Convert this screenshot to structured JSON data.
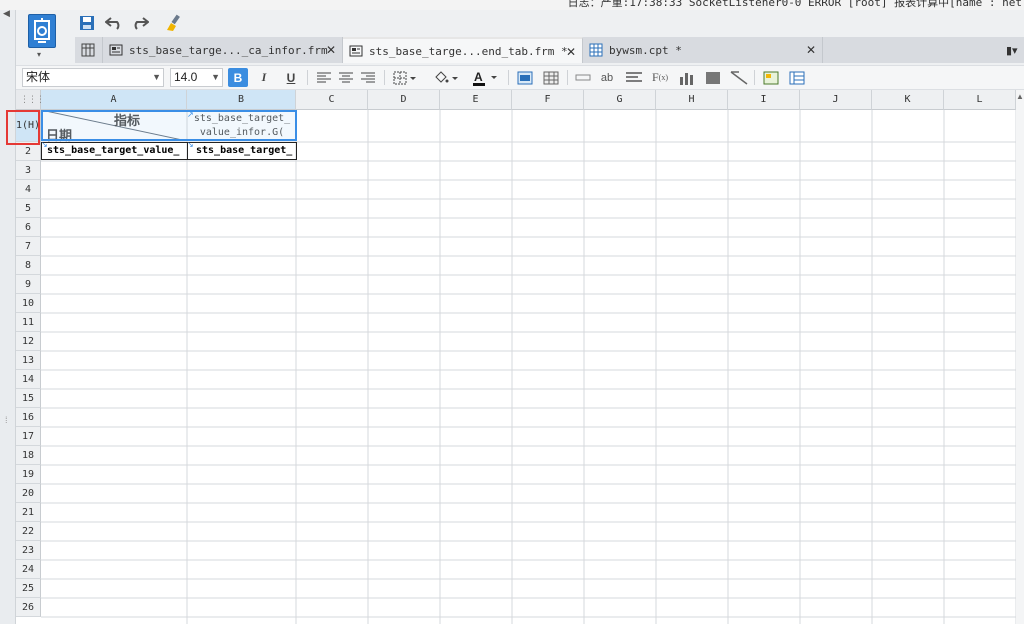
{
  "log_strip": {
    "text": "日志：严重:17:38:33 SocketListener0-0 ERROR [root] 报表计算中[name : net"
  },
  "toolbar": {
    "logo_icon": "designer-logo-icon",
    "quick_actions": [
      {
        "name": "save-icon",
        "glyph": "💾"
      },
      {
        "name": "undo-icon",
        "glyph": "↶"
      },
      {
        "name": "redo-icon",
        "glyph": "↷"
      },
      {
        "name": "clear-format-icon",
        "glyph": "🖌"
      }
    ]
  },
  "tabs": [
    {
      "label": "sts_base_targe..._ca_infor.frm",
      "active": false,
      "icon": "form-icon"
    },
    {
      "label": "sts_base_targe...end_tab.frm *",
      "active": true,
      "icon": "form-icon"
    },
    {
      "label": "bywsm.cpt *",
      "active": false,
      "icon": "report-icon"
    }
  ],
  "format_bar": {
    "font": "宋体",
    "size": "14.0",
    "bold": "B",
    "italic": "I",
    "underline": "U"
  },
  "grid": {
    "columns": [
      "A",
      "B",
      "C",
      "D",
      "E",
      "F",
      "G",
      "H",
      "I",
      "J",
      "K",
      "L"
    ],
    "rows": [
      "1(H)",
      "2",
      "3",
      "4",
      "5",
      "6",
      "7",
      "8",
      "9",
      "10",
      "11",
      "12",
      "13",
      "14",
      "15",
      "16",
      "17",
      "18",
      "19",
      "20",
      "21",
      "22",
      "23",
      "24",
      "25",
      "26"
    ],
    "cells": {
      "A1_top": "指标",
      "A1_bottom": "日期",
      "B1": "sts_base_target_ value_infor.G(",
      "A2": "sts_base_target_value_",
      "B2": "sts_base_target_"
    }
  },
  "accent_color": "#3a8ee6",
  "highlight_color": "#e53935"
}
